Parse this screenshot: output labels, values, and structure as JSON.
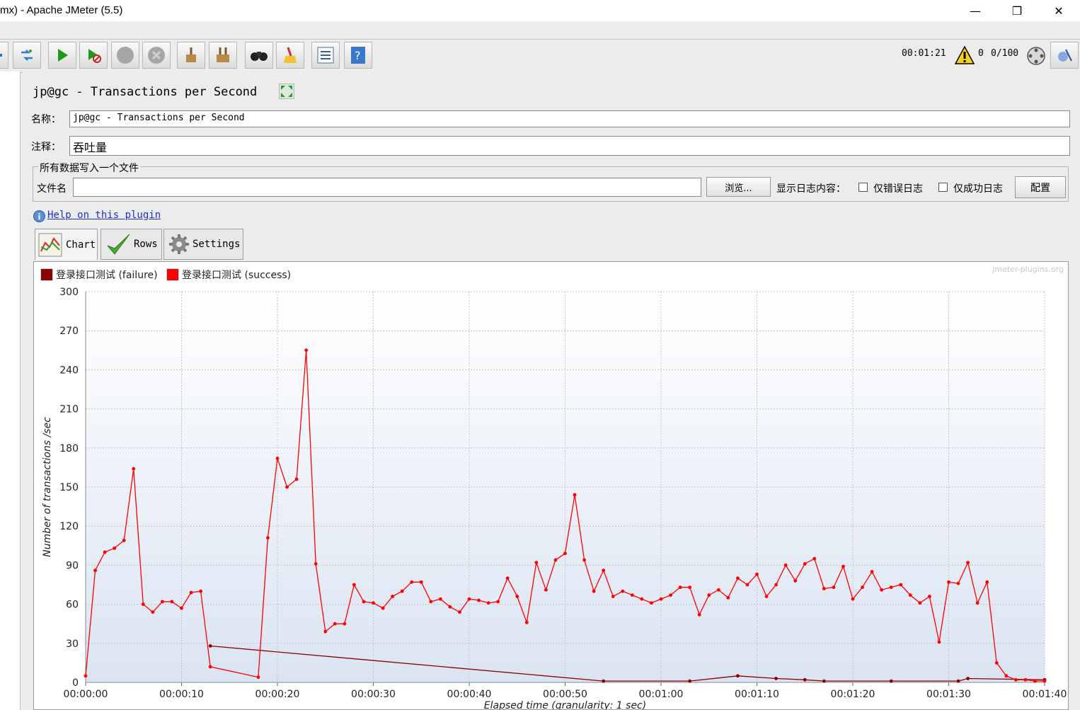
{
  "window": {
    "title": "mx) - Apache JMeter (5.5)",
    "minimize": "—",
    "maximize": "❐",
    "close": "✕"
  },
  "toolbar": {
    "timer": "00:01:21",
    "warnings": "0",
    "threads": "0/100"
  },
  "plugin": {
    "heading": "jp@gc - Transactions per Second",
    "name_label": "名称：",
    "name_value": "jp@gc - Transactions per Second",
    "comment_label": "注释：",
    "comment_value": "吞吐量",
    "file_group": "所有数据写入一个文件",
    "file_label": "文件名",
    "file_value": "",
    "browse": "浏览...",
    "log_label": "显示日志内容：",
    "errors_only": "仅错误日志",
    "success_only": "仅成功日志",
    "configure": "配置",
    "help_link": "Help on this plugin"
  },
  "tabs": [
    {
      "label": "Chart"
    },
    {
      "label": "Rows"
    },
    {
      "label": "Settings"
    }
  ],
  "chart_data": {
    "type": "line",
    "watermark": "jmeter-plugins.org",
    "ylabel": "Number of transactions /sec",
    "xlabel": "Elapsed time (granularity: 1 sec)",
    "ylim": [
      0,
      300
    ],
    "xlim_sec": [
      0,
      100
    ],
    "yticks": [
      "0",
      "30",
      "60",
      "90",
      "120",
      "150",
      "180",
      "210",
      "240",
      "270",
      "300"
    ],
    "xticks": [
      "00:00:00",
      "00:00:10",
      "00:00:20",
      "00:00:30",
      "00:00:40",
      "00:00:50",
      "00:01:00",
      "00:01:10",
      "00:01:20",
      "00:01:30",
      "00:01:40"
    ],
    "legend": [
      "登录接口测试 (failure)",
      "登录接口测试 (success)"
    ],
    "colors": {
      "failure": "#8b0000",
      "success": "#ff0000"
    },
    "series": [
      {
        "name": "登录接口测试 (failure)",
        "x": [
          13,
          54,
          63,
          68,
          72,
          75,
          77,
          84,
          91,
          92,
          100
        ],
        "values": [
          28,
          1,
          1,
          5,
          3,
          2,
          1,
          1,
          1,
          3,
          2
        ]
      },
      {
        "name": "登录接口测试 (success)",
        "x": [
          0,
          1,
          2,
          3,
          4,
          5,
          6,
          7,
          8,
          9,
          10,
          11,
          12,
          13,
          18,
          19,
          20,
          21,
          22,
          23,
          24,
          25,
          26,
          27,
          28,
          29,
          30,
          31,
          32,
          33,
          34,
          35,
          36,
          37,
          38,
          39,
          40,
          41,
          42,
          43,
          44,
          45,
          46,
          47,
          48,
          49,
          50,
          51,
          52,
          53,
          54,
          55,
          56,
          57,
          58,
          59,
          60,
          61,
          62,
          63,
          64,
          65,
          66,
          67,
          68,
          69,
          70,
          71,
          72,
          73,
          74,
          75,
          76,
          77,
          78,
          79,
          80,
          81,
          82,
          83,
          84,
          85,
          86,
          87,
          88,
          89,
          90,
          91,
          92,
          93,
          94,
          95,
          96,
          97,
          98,
          99,
          100
        ],
        "values": [
          5,
          86,
          100,
          103,
          109,
          164,
          60,
          54,
          62,
          62,
          57,
          69,
          70,
          12,
          4,
          111,
          172,
          150,
          156,
          255,
          91,
          39,
          45,
          45,
          75,
          62,
          61,
          57,
          66,
          70,
          77,
          77,
          62,
          64,
          58,
          54,
          64,
          63,
          61,
          62,
          80,
          66,
          46,
          92,
          71,
          94,
          99,
          144,
          94,
          70,
          86,
          66,
          70,
          67,
          64,
          61,
          64,
          67,
          73,
          73,
          52,
          67,
          71,
          65,
          80,
          75,
          83,
          66,
          75,
          90,
          78,
          91,
          95,
          72,
          73,
          89,
          64,
          73,
          85,
          71,
          73,
          75,
          67,
          61,
          66,
          31,
          77,
          76,
          92,
          61,
          77,
          15,
          5,
          2,
          2,
          1,
          1
        ]
      }
    ]
  }
}
